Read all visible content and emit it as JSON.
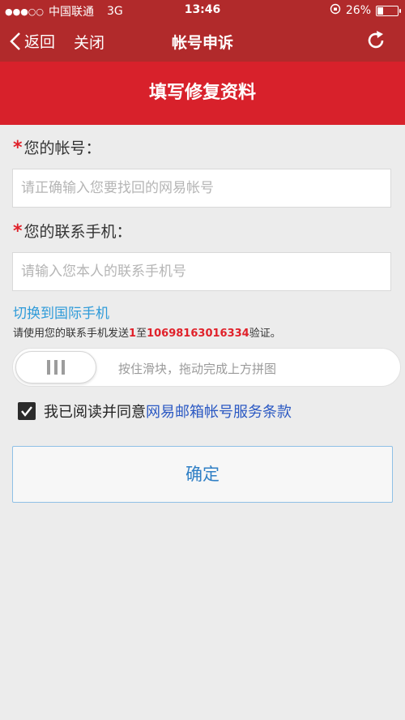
{
  "status_bar": {
    "signal": "●●●○○",
    "carrier": "中国联通",
    "network": "3G",
    "time": "13:46",
    "battery": "26%"
  },
  "nav": {
    "back_label": "返回",
    "close_label": "关闭",
    "title": "帐号申诉"
  },
  "banner": {
    "title": "填写修复资料"
  },
  "form": {
    "account_label": "您的帐号：",
    "account_placeholder": "请正确输入您要找回的网易帐号",
    "phone_label": "您的联系手机：",
    "phone_placeholder": "请输入您本人的联系手机号",
    "required_mark": "*",
    "intl_link": "切换到国际手机",
    "hint_prefix": "请使用您的联系手机发送",
    "hint_code": "1",
    "hint_mid": "至",
    "hint_number": "10698163016334",
    "hint_suffix": "验证。",
    "slider_text": "按住滑块，拖动完成上方拼图",
    "agree_text": "我已阅读并同意",
    "terms_link": "网易邮箱帐号服务条款",
    "agree_checked": true,
    "confirm_label": "确定"
  },
  "colors": {
    "nav_bg": "#b12a2b",
    "banner_bg": "#d8212b",
    "link_blue": "#2f9bd9",
    "terms_blue": "#2b59c3",
    "accent_red": "#e0212a"
  }
}
